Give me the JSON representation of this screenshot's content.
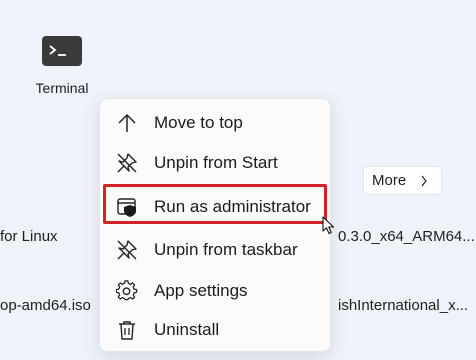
{
  "desktop": {
    "terminal_label": "Terminal",
    "left_fragments": [
      "for Linux",
      "op-amd64.iso"
    ],
    "right_fragments": [
      "0.3.0_x64_ARM64....",
      "ishInternational_x..."
    ],
    "more_label": "More"
  },
  "context_menu": {
    "items": [
      {
        "label": "Move to top",
        "icon": "arrow-up-icon"
      },
      {
        "label": "Unpin from Start",
        "icon": "unpin-icon"
      },
      {
        "label": "Run as administrator",
        "icon": "shield-window-icon"
      },
      {
        "label": "Unpin from taskbar",
        "icon": "unpin-icon"
      },
      {
        "label": "App settings",
        "icon": "gear-icon"
      },
      {
        "label": "Uninstall",
        "icon": "trash-icon"
      }
    ],
    "highlighted_item": "Run as administrator",
    "highlight_color": "#d72027"
  }
}
